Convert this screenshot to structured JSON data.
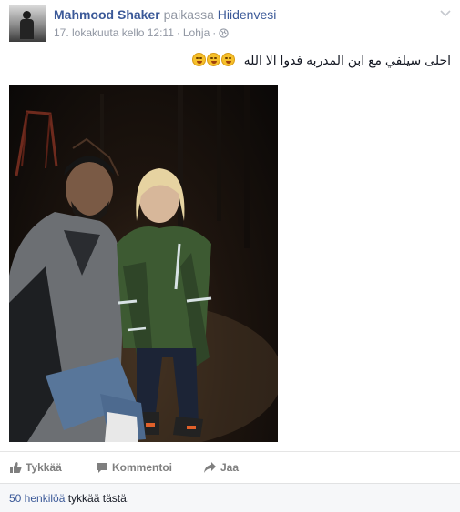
{
  "header": {
    "author_name": "Mahmood Shaker",
    "location_prefix": "paikassa",
    "location_name": "Hiidenvesi",
    "timestamp": "17. lokakuuta kello 12:11",
    "separator": "·",
    "place": "Lohja",
    "privacy_icon": "globe-icon",
    "menu_icon": "chevron-down-icon"
  },
  "post": {
    "text": "احلى سيلفي مع ابن المدربه فدوا الا الله",
    "emojis": [
      "laughing-emoji",
      "grinning-emoji",
      "crying-laughing-emoji"
    ]
  },
  "actions": {
    "like_label": "Tykkää",
    "comment_label": "Kommentoi",
    "share_label": "Jaa"
  },
  "likes": {
    "count_text": "50 henkilöä",
    "rest_text": " tykkää tästä."
  },
  "colors": {
    "link": "#3b5998",
    "muted": "#9197a3",
    "action_gray": "#7f7f7f",
    "likes_bg": "#f6f7f9"
  }
}
